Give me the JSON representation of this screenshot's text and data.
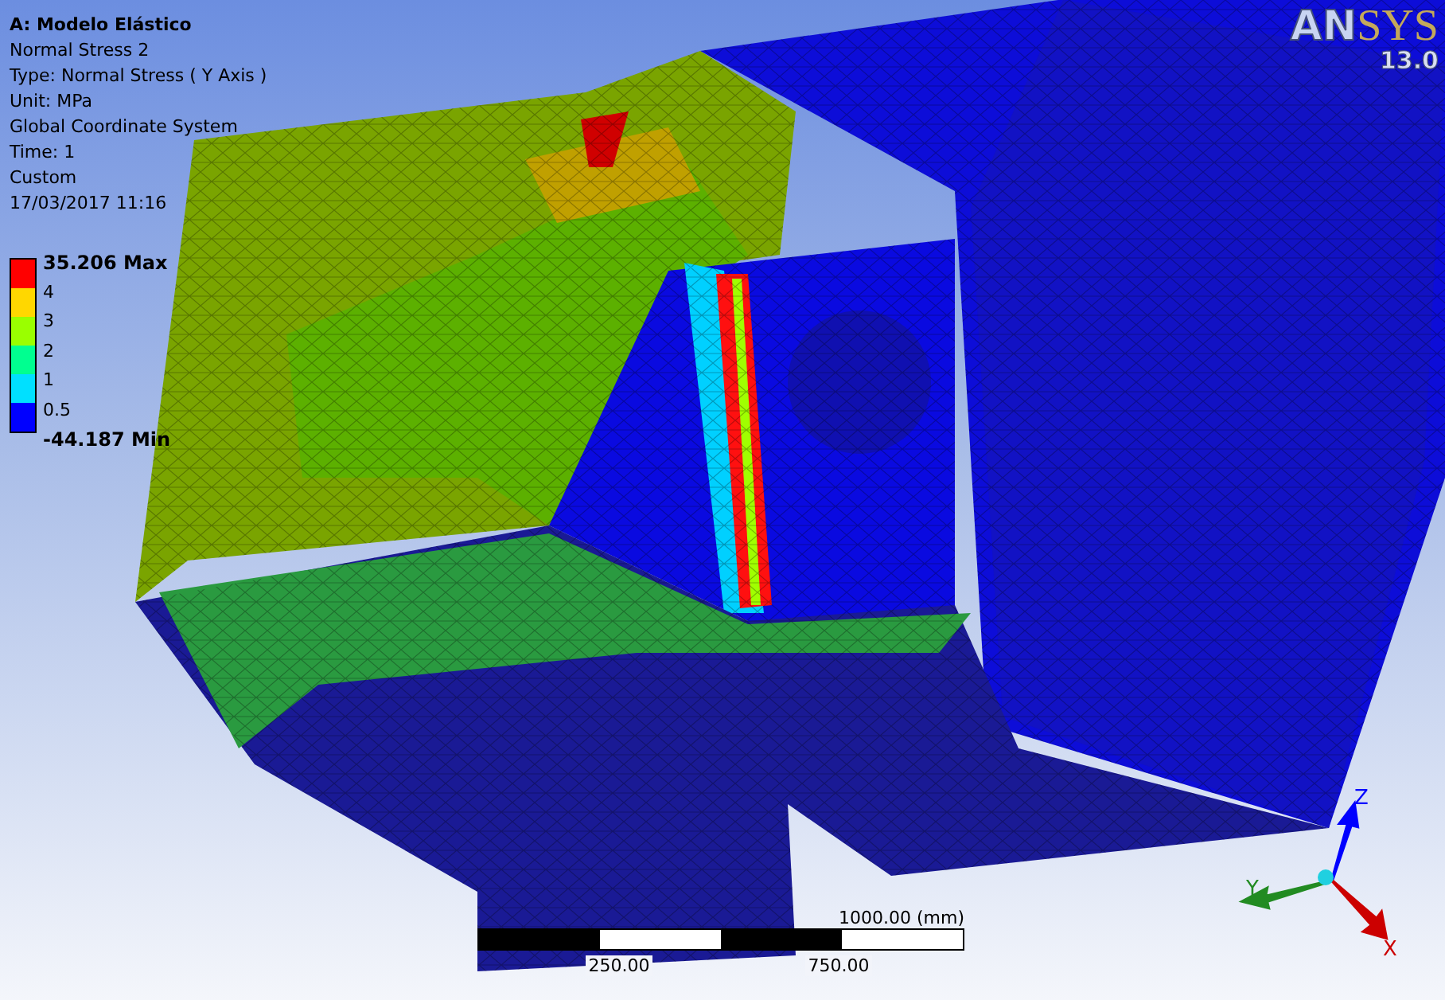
{
  "header": {
    "title": "A: Modelo Elástico",
    "lines": [
      "Normal Stress 2",
      "Type: Normal Stress ( Y Axis )",
      "Unit: MPa",
      "Global Coordinate System",
      "Time: 1",
      "Custom",
      "17/03/2017 11:16"
    ]
  },
  "legend": {
    "max": "35.206 Max",
    "min": "-44.187 Min",
    "ticks": [
      "4",
      "3",
      "2",
      "1",
      "0.5"
    ],
    "bands": [
      {
        "color": "#ff0000"
      },
      {
        "color": "#ffd700"
      },
      {
        "color": "#9aff00"
      },
      {
        "color": "#00ff90"
      },
      {
        "color": "#00e0ff"
      },
      {
        "color": "#0000ff"
      }
    ]
  },
  "logo": {
    "brand_a": "AN",
    "brand_b": "SYS",
    "version": "13.0"
  },
  "scale": {
    "end_label": "1000.00 (mm)",
    "labels": [
      "250.00",
      "750.00"
    ]
  },
  "triad": {
    "axes": [
      {
        "kind": "z",
        "label": "Z"
      },
      {
        "kind": "y",
        "label": "Y"
      },
      {
        "kind": "x",
        "label": "X"
      }
    ]
  }
}
